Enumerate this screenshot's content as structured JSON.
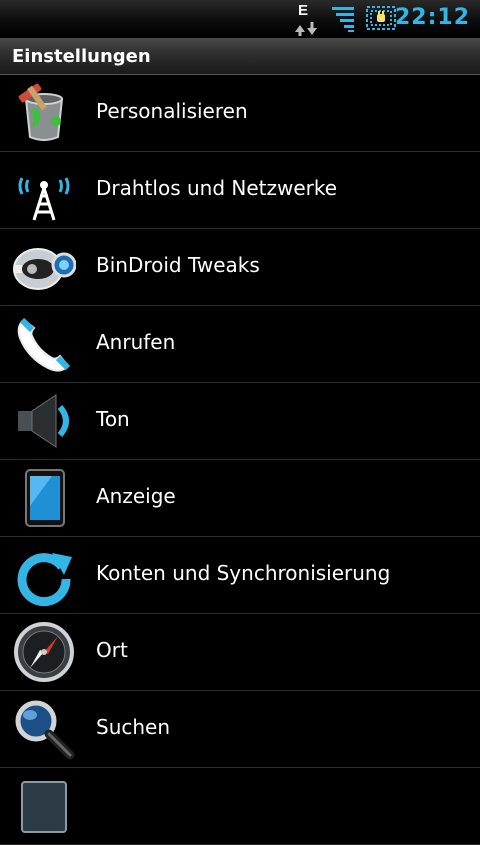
{
  "status_bar": {
    "network_type": "E",
    "time": "22:12",
    "icons": [
      "edge-data-icon",
      "signal-icon",
      "battery-charging-icon"
    ]
  },
  "header": {
    "title": "Einstellungen"
  },
  "settings": {
    "items": [
      {
        "label": "Personalisieren",
        "icon": "paint-bucket-icon"
      },
      {
        "label": "Drahtlos und Netzwerke",
        "icon": "wireless-tower-icon"
      },
      {
        "label": "BinDroid Tweaks",
        "icon": "bindroid-icon"
      },
      {
        "label": "Anrufen",
        "icon": "phone-handset-icon"
      },
      {
        "label": "Ton",
        "icon": "speaker-icon"
      },
      {
        "label": "Anzeige",
        "icon": "display-icon"
      },
      {
        "label": "Konten und Synchronisierung",
        "icon": "sync-icon"
      },
      {
        "label": "Ort",
        "icon": "compass-icon"
      },
      {
        "label": "Suchen",
        "icon": "magnifier-icon"
      }
    ]
  },
  "colors": {
    "accent": "#33b5e5",
    "background": "#000000",
    "divider": "#2b2b2b"
  }
}
